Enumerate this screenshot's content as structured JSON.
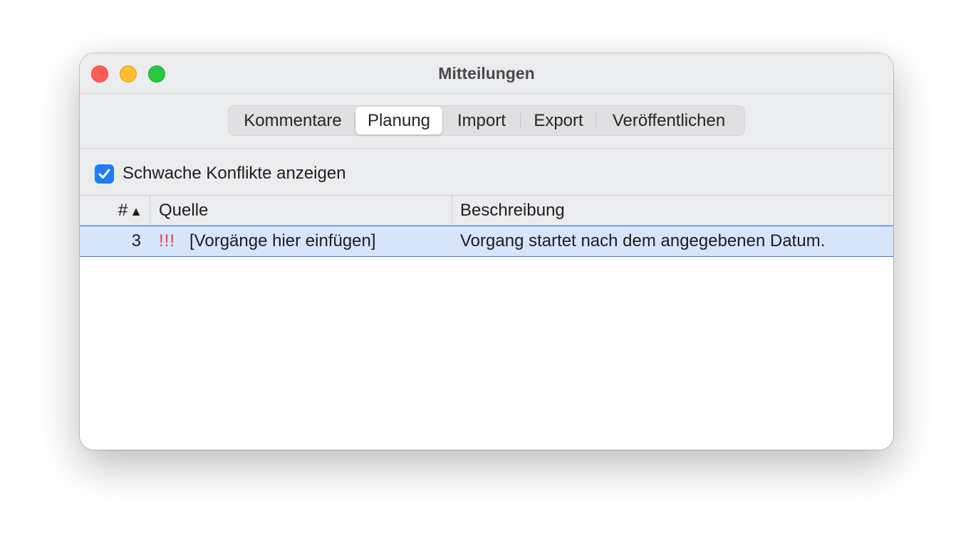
{
  "window": {
    "title": "Mitteilungen"
  },
  "tabs": [
    {
      "label": "Kommentare",
      "active": false
    },
    {
      "label": "Planung",
      "active": true
    },
    {
      "label": "Import",
      "active": false
    },
    {
      "label": "Export",
      "active": false
    },
    {
      "label": "Veröffentlichen",
      "active": false
    }
  ],
  "options": {
    "show_weak_conflicts_label": "Schwache Konflikte anzeigen",
    "show_weak_conflicts_checked": true
  },
  "table": {
    "columns": {
      "number": "#",
      "sort_indicator": "▲",
      "source": "Quelle",
      "description": "Beschreibung"
    },
    "rows": [
      {
        "number": "3",
        "priority": "!!!",
        "source": "[Vorgänge hier einfügen]",
        "description": "Vorgang startet nach dem angegebenen Datum.",
        "selected": true
      }
    ]
  },
  "colors": {
    "accent": "#1e7cf6",
    "selection": "#d6e5fa",
    "priority": "#e2453b"
  }
}
